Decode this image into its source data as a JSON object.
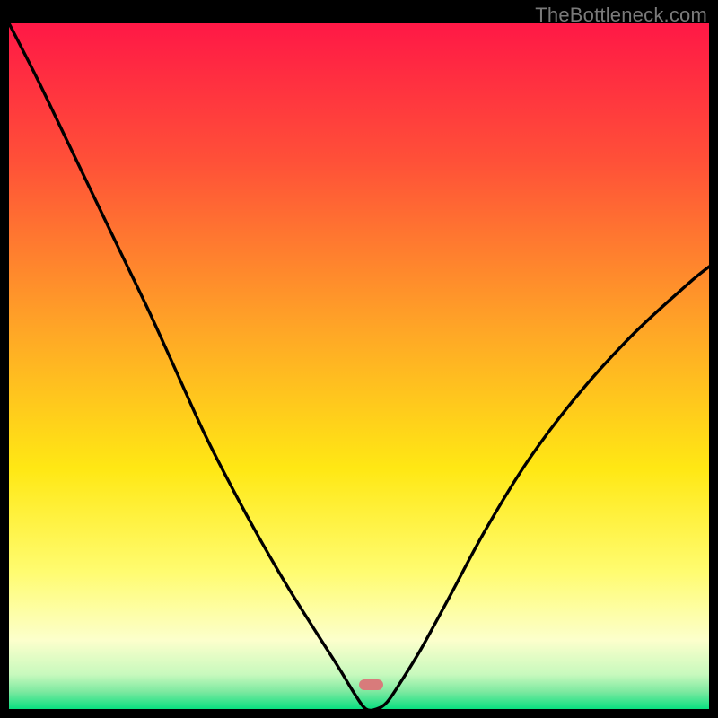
{
  "watermark": "TheBottleneck.com",
  "marker": {
    "x_fraction_start": 0.5,
    "x_fraction_end": 0.535,
    "y_fraction": 0.965
  },
  "chart_data": {
    "type": "line",
    "title": "",
    "xlabel": "",
    "ylabel": "",
    "xlim": [
      0,
      1
    ],
    "ylim": [
      0,
      1
    ],
    "gradient_stops": [
      {
        "offset": 0.0,
        "color": "#ff1846"
      },
      {
        "offset": 0.2,
        "color": "#ff5038"
      },
      {
        "offset": 0.45,
        "color": "#ffa726"
      },
      {
        "offset": 0.65,
        "color": "#ffe814"
      },
      {
        "offset": 0.8,
        "color": "#fffc70"
      },
      {
        "offset": 0.9,
        "color": "#fcffcc"
      },
      {
        "offset": 0.95,
        "color": "#c7f9bd"
      },
      {
        "offset": 0.975,
        "color": "#7ce9a0"
      },
      {
        "offset": 1.0,
        "color": "#09e080"
      }
    ],
    "series": [
      {
        "name": "bottleneck-curve",
        "x": [
          0.0,
          0.04,
          0.08,
          0.12,
          0.16,
          0.2,
          0.24,
          0.28,
          0.32,
          0.36,
          0.4,
          0.44,
          0.47,
          0.495,
          0.51,
          0.525,
          0.54,
          0.56,
          0.59,
          0.63,
          0.68,
          0.74,
          0.81,
          0.89,
          0.97,
          1.0
        ],
        "y": [
          1.0,
          0.92,
          0.835,
          0.75,
          0.665,
          0.58,
          0.49,
          0.4,
          0.32,
          0.245,
          0.175,
          0.11,
          0.062,
          0.02,
          0.0,
          0.0,
          0.01,
          0.04,
          0.09,
          0.165,
          0.26,
          0.36,
          0.455,
          0.545,
          0.62,
          0.645
        ]
      }
    ]
  }
}
